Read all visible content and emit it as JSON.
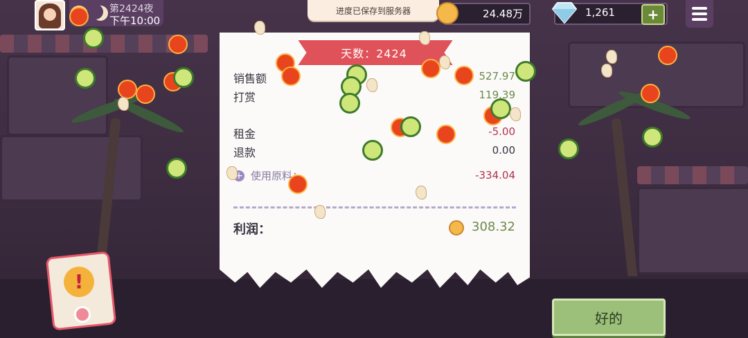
{
  "hud": {
    "day": "第2424夜",
    "time": "下午10:00",
    "toast": "进度已保存到服务器",
    "coins": "24.48万",
    "gems": "1,261",
    "plus": "+"
  },
  "receipt": {
    "banner": "天数：2424",
    "rows": [
      {
        "label": "销售额",
        "value": "527.97"
      },
      {
        "label": "打赏",
        "value": "119.39"
      },
      {
        "label": "租金",
        "value": "-5.00"
      },
      {
        "label": "退款",
        "value": "0.00"
      }
    ],
    "ingredients_label": "使用原料：",
    "ingredients_value": "-334.04",
    "expand_symbol": "+",
    "profit_label": "利润：",
    "profit_value": "308.32"
  },
  "buttons": {
    "ok": "好的",
    "alert_symbol": "!"
  },
  "colors": {
    "positive": "#6a8a4a",
    "negative": "#b0344e",
    "banner": "#e0525a",
    "ok_button": "#9cc07a"
  }
}
